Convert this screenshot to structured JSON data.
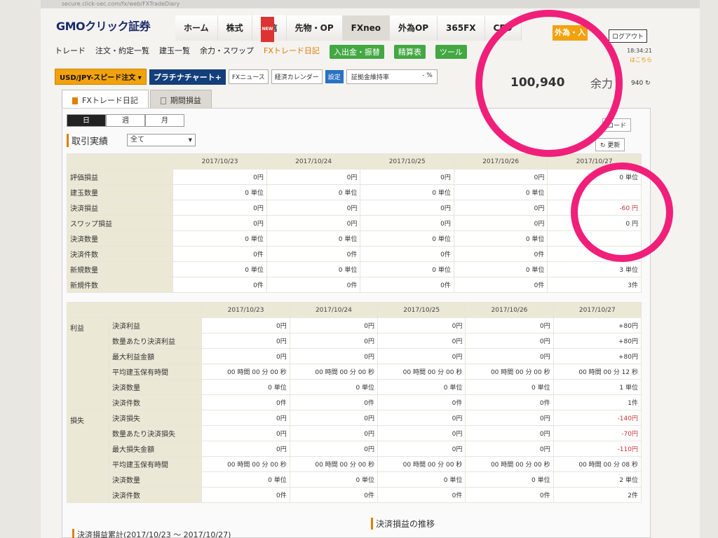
{
  "urlbar": "secure.click-sec.com/fx/web/FXTradeDiary",
  "logo": {
    "text": "GMOクリック証券"
  },
  "topnav": [
    "ホーム",
    "株式",
    "投信",
    "先物・OP",
    "FXneo",
    "外為OP",
    "365FX",
    "CFD"
  ],
  "badge_new": "NEW",
  "orange_btn": "外為・入",
  "logout": "ログアウト",
  "subnav": {
    "items": [
      "トレード",
      "注文・約定一覧",
      "建玉一覧",
      "余力・スワップ",
      "FXトレード日記"
    ],
    "green": [
      "入出金・振替",
      "精算表",
      "ツール"
    ]
  },
  "time1": "18:34:21",
  "time2": "はこちら",
  "toolbar": {
    "speed": "USD/JPY-スピード注文",
    "platinum": "プラチナチャート+",
    "fxnews": "FXニュース",
    "calendar": "経済カレンダー",
    "settings": "設定",
    "margin_label": "証拠金維持率",
    "margin_value": "- %"
  },
  "balance": {
    "value": "100,940",
    "label": "余力",
    "small": "940"
  },
  "tabs": [
    "FXトレード日記",
    "期間損益"
  ],
  "seg": [
    "日",
    "週",
    "月"
  ],
  "section_title": "取引実績",
  "filter": "全て",
  "download": "ロード",
  "refresh": "更新",
  "dates": [
    "2017/10/23",
    "2017/10/24",
    "2017/10/25",
    "2017/10/26",
    "2017/10/27"
  ],
  "table1": [
    {
      "label": "評価損益",
      "values": [
        "0円",
        "0円",
        "0円",
        "0円",
        "0 単位"
      ]
    },
    {
      "label": "建玉数量",
      "values": [
        "0 単位",
        "0 単位",
        "0 単位",
        "0 単位",
        ""
      ]
    },
    {
      "label": "決済損益",
      "values": [
        "0円",
        "0円",
        "0円",
        "0円",
        "-60 円"
      ]
    },
    {
      "label": "スワップ損益",
      "values": [
        "0円",
        "0円",
        "0円",
        "0円",
        "0 円"
      ]
    },
    {
      "label": "決済数量",
      "values": [
        "0 単位",
        "0 単位",
        "0 単位",
        "0 単位",
        ""
      ]
    },
    {
      "label": "決済件数",
      "values": [
        "0件",
        "0件",
        "0件",
        "0件",
        ""
      ]
    },
    {
      "label": "新規数量",
      "values": [
        "0 単位",
        "0 単位",
        "0 単位",
        "0 単位",
        "3 単位"
      ]
    },
    {
      "label": "新規件数",
      "values": [
        "0件",
        "0件",
        "0件",
        "0件",
        "3件"
      ]
    }
  ],
  "table2_groups": [
    "利益",
    "損失"
  ],
  "table2": [
    {
      "label": "決済利益",
      "values": [
        "0円",
        "0円",
        "0円",
        "0円",
        "+80円"
      ]
    },
    {
      "label": "数量あたり決済利益",
      "values": [
        "0円",
        "0円",
        "0円",
        "0円",
        "+80円"
      ]
    },
    {
      "label": "最大利益金額",
      "values": [
        "0円",
        "0円",
        "0円",
        "0円",
        "+80円"
      ]
    },
    {
      "label": "平均建玉保有時間",
      "values": [
        "00 時間 00 分 00 秒",
        "00 時間 00 分 00 秒",
        "00 時間 00 分 00 秒",
        "00 時間 00 分 00 秒",
        "00 時間 00 分 12 秒"
      ]
    },
    {
      "label": "決済数量",
      "values": [
        "0 単位",
        "0 単位",
        "0 単位",
        "0 単位",
        "1 単位"
      ]
    },
    {
      "label": "決済件数",
      "values": [
        "0件",
        "0件",
        "0件",
        "0件",
        "1件"
      ]
    },
    {
      "label": "決済損失",
      "values": [
        "0円",
        "0円",
        "0円",
        "0円",
        "-140円"
      ]
    },
    {
      "label": "数量あたり決済損失",
      "values": [
        "0円",
        "0円",
        "0円",
        "0円",
        "-70円"
      ]
    },
    {
      "label": "最大損失金額",
      "values": [
        "0円",
        "0円",
        "0円",
        "0円",
        "-110円"
      ]
    },
    {
      "label": "平均建玉保有時間",
      "values": [
        "00 時間 00 分 00 秒",
        "00 時間 00 分 00 秒",
        "00 時間 00 分 00 秒",
        "00 時間 00 分 00 秒",
        "00 時間 00 分 08 秒"
      ]
    },
    {
      "label": "決済数量",
      "values": [
        "0 単位",
        "0 単位",
        "0 単位",
        "0 単位",
        "2 単位"
      ]
    },
    {
      "label": "決済件数",
      "values": [
        "0件",
        "0件",
        "0件",
        "0件",
        "2件"
      ]
    }
  ],
  "bottom_left": "決済損益累計(2017/10/23 〜 2017/10/27)",
  "bottom_right": "決済損益の推移",
  "annotation_color": "#f0207a"
}
